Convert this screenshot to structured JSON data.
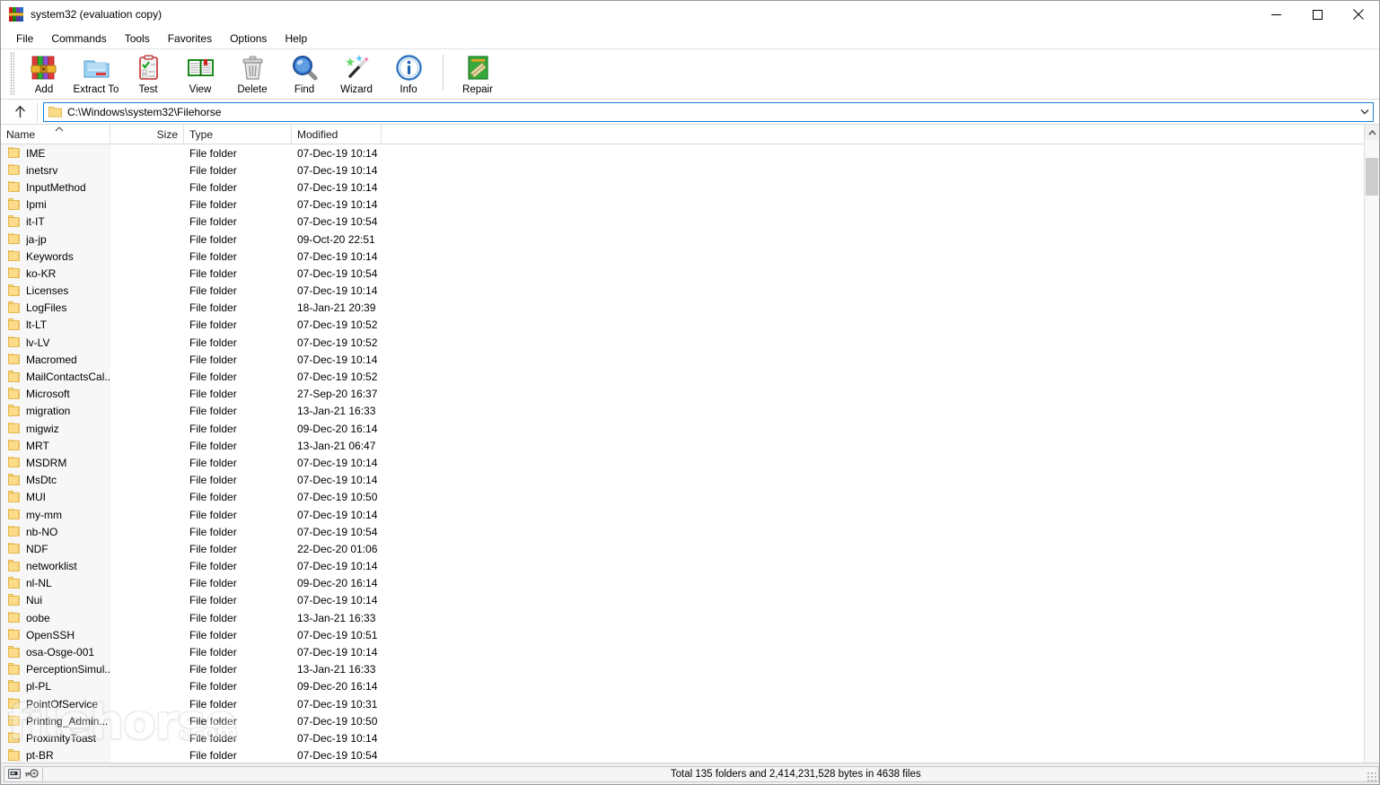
{
  "window": {
    "title": "system32 (evaluation copy)",
    "app_icon": "winrar-books-icon",
    "controls": {
      "minimize": "minimize-icon",
      "maximize": "maximize-icon",
      "close": "close-icon"
    }
  },
  "menubar": {
    "items": [
      {
        "label": "File"
      },
      {
        "label": "Commands"
      },
      {
        "label": "Tools"
      },
      {
        "label": "Favorites"
      },
      {
        "label": "Options"
      },
      {
        "label": "Help"
      }
    ]
  },
  "toolbar": {
    "buttons": [
      {
        "label": "Add",
        "icon": "add-archive-icon"
      },
      {
        "label": "Extract To",
        "icon": "extract-folder-icon"
      },
      {
        "label": "Test",
        "icon": "test-clipboard-icon"
      },
      {
        "label": "View",
        "icon": "view-book-icon"
      },
      {
        "label": "Delete",
        "icon": "delete-trash-icon"
      },
      {
        "label": "Find",
        "icon": "find-magnifier-icon"
      },
      {
        "label": "Wizard",
        "icon": "wizard-wand-icon"
      },
      {
        "label": "Info",
        "icon": "info-circle-icon"
      }
    ],
    "after_separator": [
      {
        "label": "Repair",
        "icon": "repair-icon"
      }
    ]
  },
  "addressbar": {
    "up_icon": "up-arrow-icon",
    "folder_icon": "folder-icon",
    "path": "C:\\Windows\\system32\\Filehorse",
    "chevron_icon": "chevron-down-icon"
  },
  "filelist": {
    "columns": [
      {
        "key": "name",
        "label": "Name",
        "sorted": true,
        "sort_direction": "ascending"
      },
      {
        "key": "size",
        "label": "Size"
      },
      {
        "key": "type",
        "label": "Type"
      },
      {
        "key": "modified",
        "label": "Modified"
      }
    ],
    "rows": [
      {
        "name": "IME",
        "size": "",
        "type": "File folder",
        "modified": "07-Dec-19 10:14"
      },
      {
        "name": "inetsrv",
        "size": "",
        "type": "File folder",
        "modified": "07-Dec-19 10:14"
      },
      {
        "name": "InputMethod",
        "size": "",
        "type": "File folder",
        "modified": "07-Dec-19 10:14"
      },
      {
        "name": "Ipmi",
        "size": "",
        "type": "File folder",
        "modified": "07-Dec-19 10:14"
      },
      {
        "name": "it-IT",
        "size": "",
        "type": "File folder",
        "modified": "07-Dec-19 10:54"
      },
      {
        "name": "ja-jp",
        "size": "",
        "type": "File folder",
        "modified": "09-Oct-20 22:51"
      },
      {
        "name": "Keywords",
        "size": "",
        "type": "File folder",
        "modified": "07-Dec-19 10:14"
      },
      {
        "name": "ko-KR",
        "size": "",
        "type": "File folder",
        "modified": "07-Dec-19 10:54"
      },
      {
        "name": "Licenses",
        "size": "",
        "type": "File folder",
        "modified": "07-Dec-19 10:14"
      },
      {
        "name": "LogFiles",
        "size": "",
        "type": "File folder",
        "modified": "18-Jan-21 20:39"
      },
      {
        "name": "lt-LT",
        "size": "",
        "type": "File folder",
        "modified": "07-Dec-19 10:52"
      },
      {
        "name": "lv-LV",
        "size": "",
        "type": "File folder",
        "modified": "07-Dec-19 10:52"
      },
      {
        "name": "Macromed",
        "size": "",
        "type": "File folder",
        "modified": "07-Dec-19 10:14"
      },
      {
        "name": "MailContactsCal...",
        "size": "",
        "type": "File folder",
        "modified": "07-Dec-19 10:52"
      },
      {
        "name": "Microsoft",
        "size": "",
        "type": "File folder",
        "modified": "27-Sep-20 16:37"
      },
      {
        "name": "migration",
        "size": "",
        "type": "File folder",
        "modified": "13-Jan-21 16:33"
      },
      {
        "name": "migwiz",
        "size": "",
        "type": "File folder",
        "modified": "09-Dec-20 16:14"
      },
      {
        "name": "MRT",
        "size": "",
        "type": "File folder",
        "modified": "13-Jan-21 06:47"
      },
      {
        "name": "MSDRM",
        "size": "",
        "type": "File folder",
        "modified": "07-Dec-19 10:14"
      },
      {
        "name": "MsDtc",
        "size": "",
        "type": "File folder",
        "modified": "07-Dec-19 10:14"
      },
      {
        "name": "MUI",
        "size": "",
        "type": "File folder",
        "modified": "07-Dec-19 10:50"
      },
      {
        "name": "my-mm",
        "size": "",
        "type": "File folder",
        "modified": "07-Dec-19 10:14"
      },
      {
        "name": "nb-NO",
        "size": "",
        "type": "File folder",
        "modified": "07-Dec-19 10:54"
      },
      {
        "name": "NDF",
        "size": "",
        "type": "File folder",
        "modified": "22-Dec-20 01:06"
      },
      {
        "name": "networklist",
        "size": "",
        "type": "File folder",
        "modified": "07-Dec-19 10:14"
      },
      {
        "name": "nl-NL",
        "size": "",
        "type": "File folder",
        "modified": "09-Dec-20 16:14"
      },
      {
        "name": "Nui",
        "size": "",
        "type": "File folder",
        "modified": "07-Dec-19 10:14"
      },
      {
        "name": "oobe",
        "size": "",
        "type": "File folder",
        "modified": "13-Jan-21 16:33"
      },
      {
        "name": "OpenSSH",
        "size": "",
        "type": "File folder",
        "modified": "07-Dec-19 10:51"
      },
      {
        "name": "osa-Osge-001",
        "size": "",
        "type": "File folder",
        "modified": "07-Dec-19 10:14"
      },
      {
        "name": "PerceptionSimul...",
        "size": "",
        "type": "File folder",
        "modified": "13-Jan-21 16:33"
      },
      {
        "name": "pl-PL",
        "size": "",
        "type": "File folder",
        "modified": "09-Dec-20 16:14"
      },
      {
        "name": "PointOfService",
        "size": "",
        "type": "File folder",
        "modified": "07-Dec-19 10:31"
      },
      {
        "name": "Printing_Admin...",
        "size": "",
        "type": "File folder",
        "modified": "07-Dec-19 10:50"
      },
      {
        "name": "ProximityToast",
        "size": "",
        "type": "File folder",
        "modified": "07-Dec-19 10:14"
      },
      {
        "name": "pt-BR",
        "size": "",
        "type": "File folder",
        "modified": "07-Dec-19 10:54"
      }
    ]
  },
  "scrollbar": {
    "up_arrow_icon": "scroll-up-arrow-icon"
  },
  "watermark": {
    "text": "filehorse",
    "suffix": ".com"
  },
  "statusbar": {
    "drive_icon": "drive-icon",
    "key_icon": "key-icon",
    "message": "Total 135 folders and 2,414,231,528 bytes in 4638 files"
  },
  "colors": {
    "accent": "#1a7fd4",
    "folder": "#fcdc8a",
    "chrome": "#f0f0f0"
  }
}
